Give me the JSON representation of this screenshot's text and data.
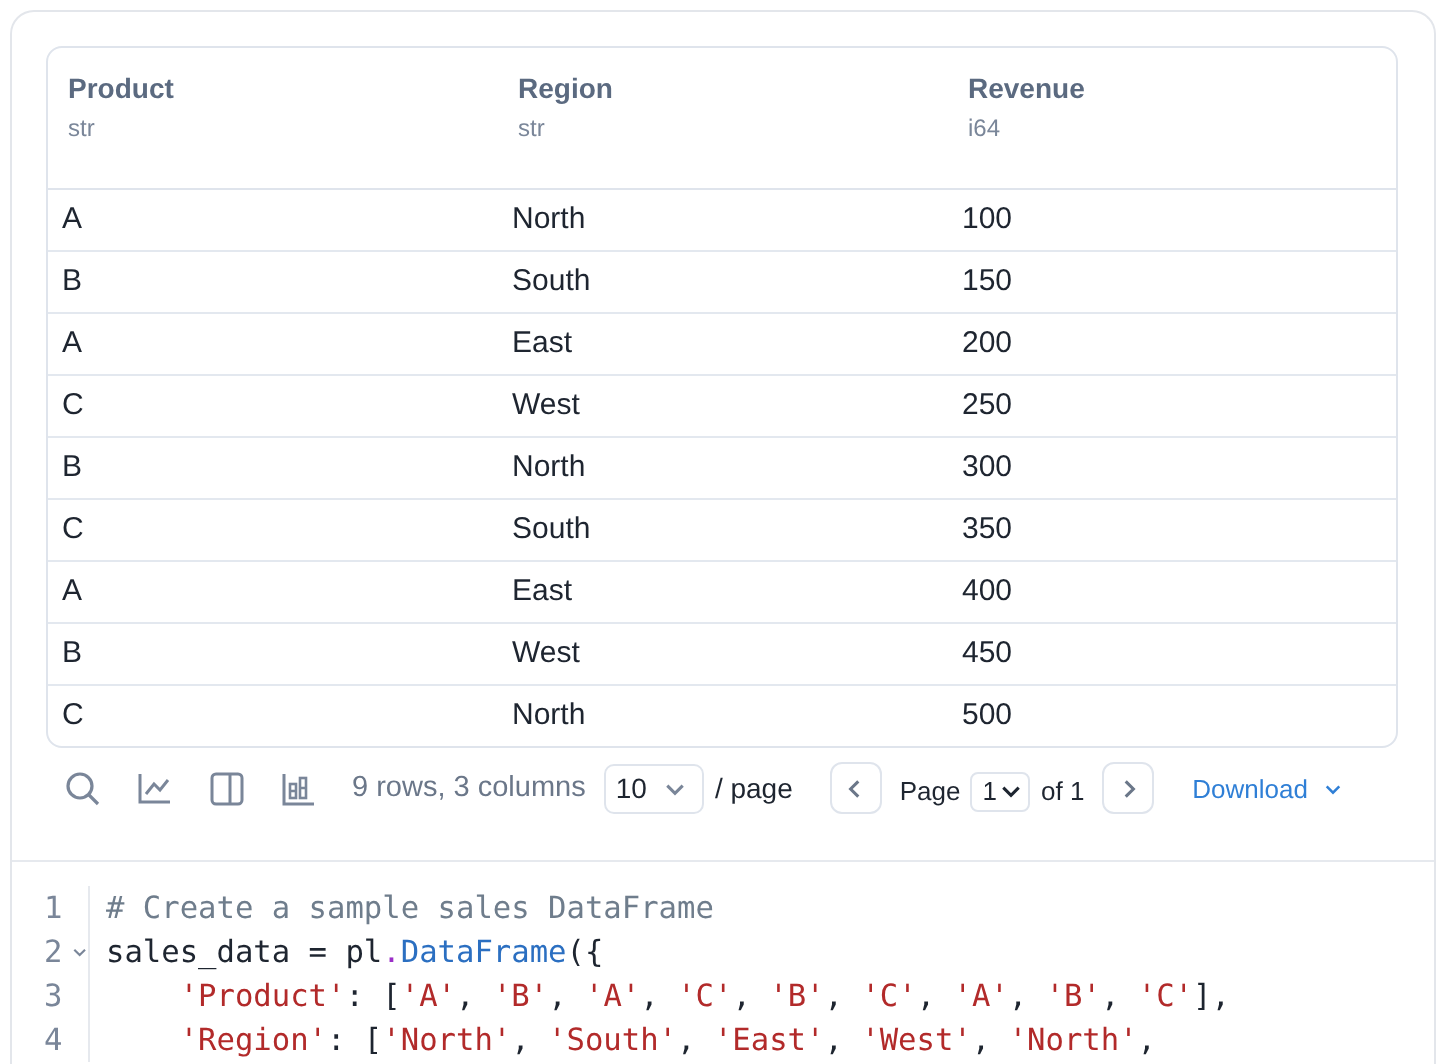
{
  "table": {
    "columns": [
      {
        "name": "Product",
        "dtype": "str"
      },
      {
        "name": "Region",
        "dtype": "str"
      },
      {
        "name": "Revenue",
        "dtype": "i64"
      }
    ],
    "rows": [
      [
        "A",
        "North",
        "100"
      ],
      [
        "B",
        "South",
        "150"
      ],
      [
        "A",
        "East",
        "200"
      ],
      [
        "C",
        "West",
        "250"
      ],
      [
        "B",
        "North",
        "300"
      ],
      [
        "C",
        "South",
        "350"
      ],
      [
        "A",
        "East",
        "400"
      ],
      [
        "B",
        "West",
        "450"
      ],
      [
        "C",
        "North",
        "500"
      ]
    ]
  },
  "toolbar": {
    "summary": "9 rows, 3 columns",
    "page_size": "10",
    "page_size_suffix": "/ page",
    "page_label": "Page",
    "page": "1",
    "page_total": "of 1",
    "download": "Download"
  },
  "code": {
    "lines": [
      {
        "number": "1",
        "foldable": false,
        "tokens": [
          {
            "kind": "comment",
            "text": "# Create a sample sales DataFrame"
          }
        ]
      },
      {
        "number": "2",
        "foldable": true,
        "tokens": [
          {
            "kind": "plain",
            "text": "sales_data = pl"
          },
          {
            "kind": "op",
            "text": "."
          },
          {
            "kind": "func",
            "text": "DataFrame"
          },
          {
            "kind": "plain",
            "text": "({"
          }
        ]
      },
      {
        "number": "3",
        "foldable": false,
        "tokens": [
          {
            "kind": "string",
            "text": "    'Product'"
          },
          {
            "kind": "plain",
            "text": ": ["
          },
          {
            "kind": "string",
            "text": "'A'"
          },
          {
            "kind": "plain",
            "text": ", "
          },
          {
            "kind": "string",
            "text": "'B'"
          },
          {
            "kind": "plain",
            "text": ", "
          },
          {
            "kind": "string",
            "text": "'A'"
          },
          {
            "kind": "plain",
            "text": ", "
          },
          {
            "kind": "string",
            "text": "'C'"
          },
          {
            "kind": "plain",
            "text": ", "
          },
          {
            "kind": "string",
            "text": "'B'"
          },
          {
            "kind": "plain",
            "text": ", "
          },
          {
            "kind": "string",
            "text": "'C'"
          },
          {
            "kind": "plain",
            "text": ", "
          },
          {
            "kind": "string",
            "text": "'A'"
          },
          {
            "kind": "plain",
            "text": ", "
          },
          {
            "kind": "string",
            "text": "'B'"
          },
          {
            "kind": "plain",
            "text": ", "
          },
          {
            "kind": "string",
            "text": "'C'"
          },
          {
            "kind": "plain",
            "text": "],"
          }
        ]
      },
      {
        "number": "4",
        "foldable": false,
        "tokens": [
          {
            "kind": "string",
            "text": "    'Region'"
          },
          {
            "kind": "plain",
            "text": ": ["
          },
          {
            "kind": "string",
            "text": "'North'"
          },
          {
            "kind": "plain",
            "text": ", "
          },
          {
            "kind": "string",
            "text": "'South'"
          },
          {
            "kind": "plain",
            "text": ", "
          },
          {
            "kind": "string",
            "text": "'East'"
          },
          {
            "kind": "plain",
            "text": ", "
          },
          {
            "kind": "string",
            "text": "'West'"
          },
          {
            "kind": "plain",
            "text": ", "
          },
          {
            "kind": "string",
            "text": "'North'"
          },
          {
            "kind": "plain",
            "text": ","
          }
        ]
      }
    ]
  }
}
